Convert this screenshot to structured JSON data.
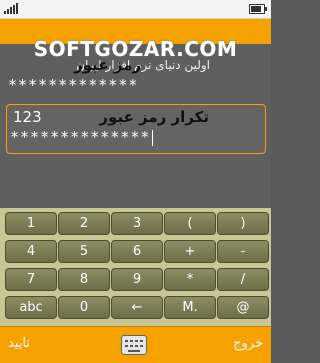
{
  "watermark": {
    "brand": "SOFTGOZAR.COM",
    "subtitle": "اولین دنیای نرم افزار ایران"
  },
  "form": {
    "password_label": "رمز عبور",
    "password_value": "*************",
    "confirm_label": "تکرار رمز عبور",
    "confirm_prefix": "123",
    "confirm_value": "**************"
  },
  "keypad": {
    "rows": [
      [
        "1",
        "2",
        "3",
        "(",
        ")"
      ],
      [
        "4",
        "5",
        "6",
        "+",
        "-"
      ],
      [
        "7",
        "8",
        "9",
        "*",
        "/"
      ],
      [
        "abc",
        "0",
        "←",
        "M.",
        "@"
      ]
    ]
  },
  "softkeys": {
    "right": "خروج",
    "left": "تایید",
    "center_icon": "keyboard-icon"
  },
  "colors": {
    "accent": "#f5a200",
    "key": "#7f7d55",
    "keypad_bg": "#c9c695",
    "screen_bg": "#5f5f5f"
  }
}
